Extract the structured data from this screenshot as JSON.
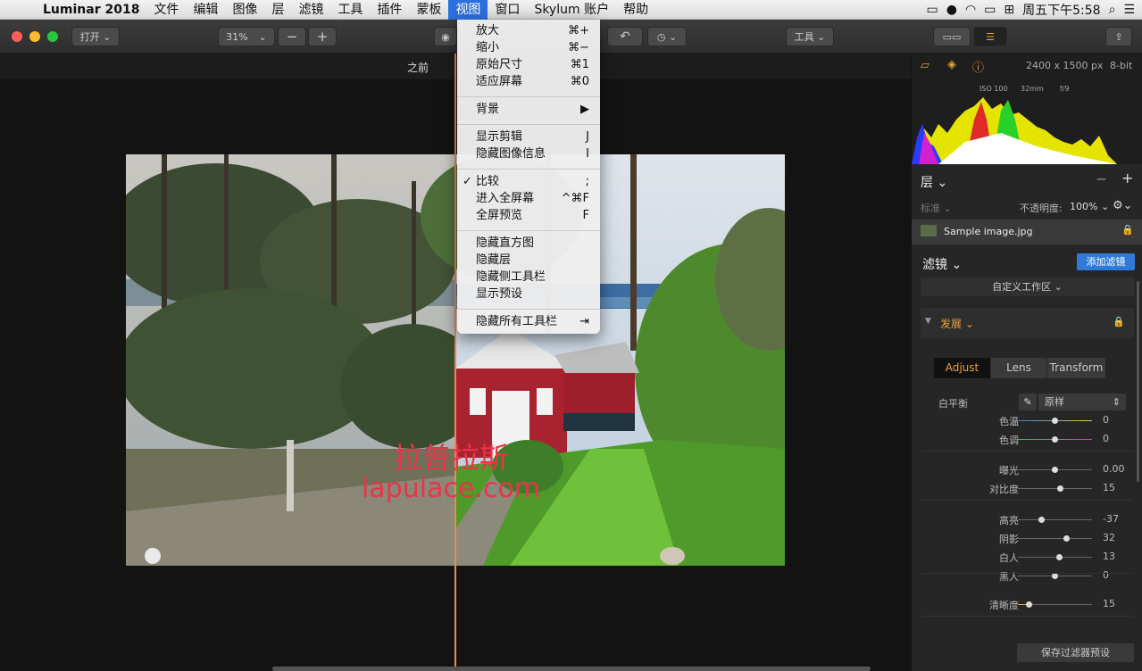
{
  "menubar": {
    "app": "Luminar 2018",
    "items": [
      "文件",
      "编辑",
      "图像",
      "层",
      "滤镜",
      "工具",
      "插件",
      "蒙板",
      "视图",
      "窗口",
      "Skylum 账户",
      "帮助"
    ],
    "active": "视图",
    "clock": "周五下午5:58"
  },
  "toolbar": {
    "open_label": "打开 ⌄",
    "zoom_label": "31%",
    "tools_label": "工具 ⌄"
  },
  "compare_label": "之前",
  "view_menu": {
    "items": [
      {
        "label": "放大",
        "shortcut": "⌘+"
      },
      {
        "label": "缩小",
        "shortcut": "⌘−"
      },
      {
        "label": "原始尺寸",
        "shortcut": "⌘1"
      },
      {
        "label": "适应屏幕",
        "shortcut": "⌘0"
      },
      {
        "label": "背景",
        "shortcut": "▶"
      },
      {
        "label": "显示剪辑",
        "shortcut": "J"
      },
      {
        "label": "隐藏图像信息",
        "shortcut": "I"
      },
      {
        "label": "比较",
        "shortcut": ";"
      },
      {
        "label": "进入全屏幕",
        "shortcut": "^⌘F"
      },
      {
        "label": "全屏预览",
        "shortcut": "F"
      },
      {
        "label": "隐藏直方图",
        "shortcut": ""
      },
      {
        "label": "隐藏层",
        "shortcut": ""
      },
      {
        "label": "隐藏侧工具栏",
        "shortcut": ""
      },
      {
        "label": "显示预设",
        "shortcut": ""
      },
      {
        "label": "隐藏所有工具栏",
        "shortcut": "⇥"
      }
    ],
    "checkmark": "✓"
  },
  "watermark": {
    "line1": "拉普拉斯",
    "line2": "lapulace.com"
  },
  "panel": {
    "image_size": "2400 x 1500 px",
    "bit_depth": "8-bit",
    "exif": {
      "iso": "ISO 100",
      "focal": "32mm",
      "aperture": "f/9"
    },
    "layers_title": "层 ⌄",
    "blend_mode": "标准 ⌄",
    "opacity_label": "不透明度:",
    "opacity_value": "100% ⌄",
    "layer_name": "Sample image.jpg",
    "filters_title": "滤镜 ⌄",
    "add_filter_label": "添加滤镜",
    "workspace_label": "自定义工作区 ⌄",
    "develop_title": "发展 ⌄",
    "tabs": [
      "Adjust",
      "Lens",
      "Transform"
    ],
    "wb_label": "白平衡",
    "wb_value": "原样",
    "sliders": [
      {
        "label": "色温",
        "value": "0",
        "pos": 0.5
      },
      {
        "label": "色调",
        "value": "0",
        "pos": 0.5
      },
      {
        "label": "曝光",
        "value": "0.00",
        "pos": 0.5
      },
      {
        "label": "对比度",
        "value": "15",
        "pos": 0.575
      },
      {
        "label": "高亮",
        "value": "-37",
        "pos": 0.315
      },
      {
        "label": "阴影",
        "value": "32",
        "pos": 0.66
      },
      {
        "label": "白人",
        "value": "13",
        "pos": 0.565
      },
      {
        "label": "黑人",
        "value": "0",
        "pos": 0.5
      },
      {
        "label": "清晰度",
        "value": "15",
        "pos": 0.15
      }
    ],
    "save_preset_label": "保存过滤器预设"
  },
  "colors": {
    "accent": "#2c6fe0",
    "orange": "#e8895a",
    "filter_btn": "#2f7ad9",
    "develop": "#e8a23b"
  }
}
